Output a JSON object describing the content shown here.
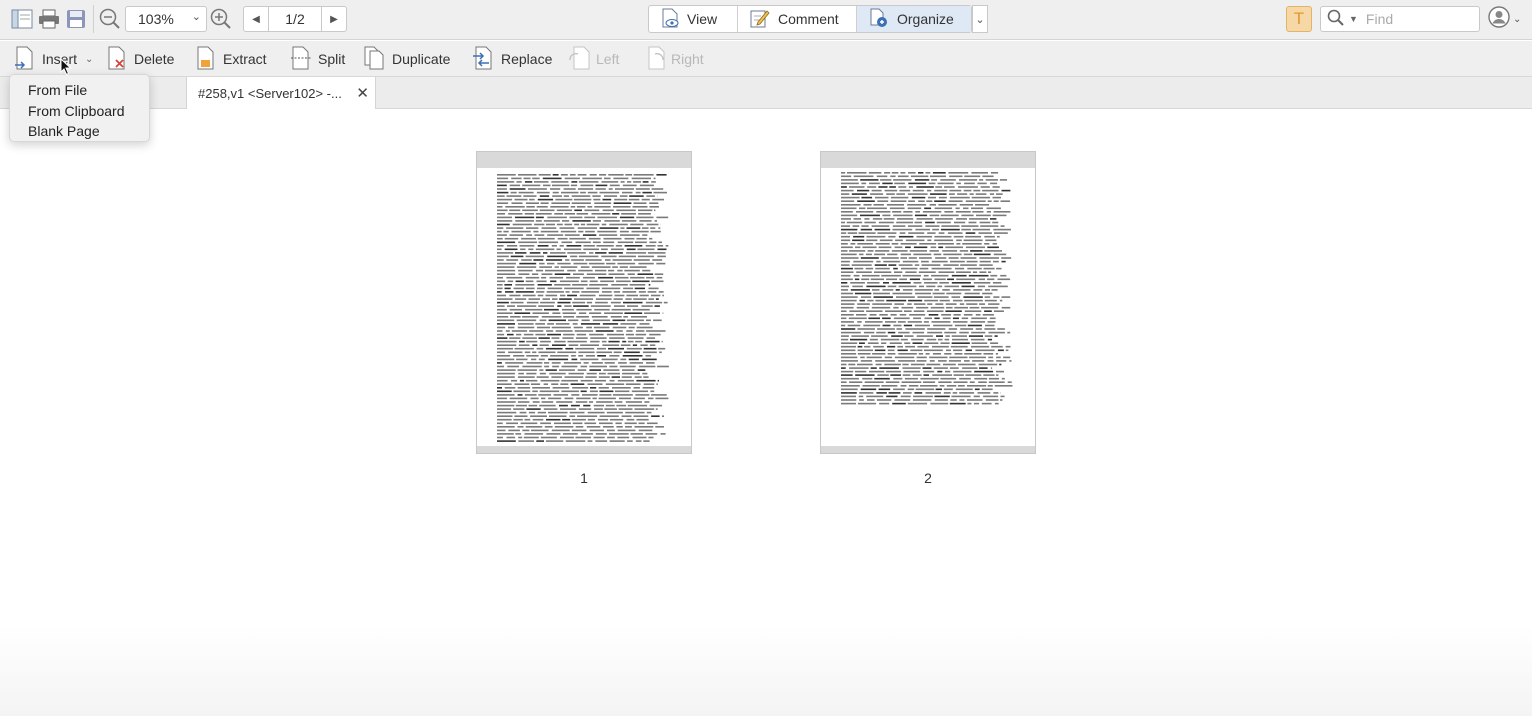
{
  "toolbar": {
    "zoom": "103%",
    "page_indicator": "1/2",
    "modes": [
      {
        "label": "View",
        "icon": "eye-document-icon"
      },
      {
        "label": "Comment",
        "icon": "pen-note-icon"
      },
      {
        "label": "Organize",
        "icon": "organize-pages-icon"
      }
    ],
    "active_mode": "Organize",
    "search_placeholder": "Find",
    "accent": "#e09a30"
  },
  "organize": {
    "insert": "Insert",
    "delete": "Delete",
    "extract": "Extract",
    "split": "Split",
    "duplicate": "Duplicate",
    "replace": "Replace",
    "left": "Left",
    "right": "Right"
  },
  "insert_menu": {
    "items": [
      "From File",
      "From Clipboard",
      "Blank Page"
    ]
  },
  "tab": {
    "title": "#258,v1 <Server102> -..."
  },
  "pages": [
    {
      "number": "1"
    },
    {
      "number": "2"
    }
  ]
}
